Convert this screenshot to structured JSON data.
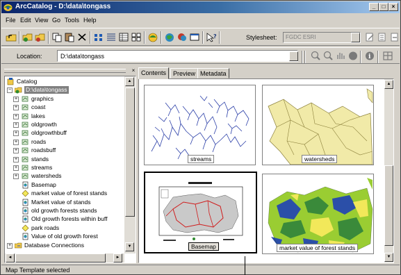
{
  "window": {
    "title": "ArcCatalog - D:\\data\\tongass",
    "minimize_glyph": "_",
    "maximize_glyph": "□",
    "close_glyph": "×"
  },
  "menu": [
    "File",
    "Edit",
    "View",
    "Go",
    "Tools",
    "Help"
  ],
  "toolbar": {
    "icons": [
      "up-one-level-icon",
      "connect-folder-icon",
      "disconnect-folder-icon",
      "copy-icon",
      "paste-icon",
      "delete-icon",
      "large-icons-icon",
      "list-icon",
      "details-icon",
      "thumbnails-icon",
      "launch-arcmap-icon",
      "metadata-icon",
      "search-icon",
      "arctoolbox-icon",
      "whats-this-icon"
    ],
    "stylesheet_label": "Stylesheet:",
    "stylesheet_value": "FGDC ESRI",
    "right_icons": [
      "edit-metadata-icon",
      "metadata-properties-icon",
      "import-metadata-icon"
    ]
  },
  "location": {
    "label": "Location:",
    "value": "D:\\data\\tongass",
    "tool_icons": [
      "zoom-in-icon",
      "zoom-out-icon",
      "pan-icon",
      "full-extent-icon",
      "identify-icon",
      "create-thumbnail-icon"
    ]
  },
  "tree": {
    "close_glyph": "×",
    "items": [
      {
        "label": "Catalog",
        "icon": "catalog-icon",
        "level": 0,
        "expander": ""
      },
      {
        "label": "D:\\data\\tongass",
        "icon": "folder-connection-icon",
        "level": 1,
        "expander": "−"
      },
      {
        "label": "graphics",
        "icon": "coverage-icon",
        "level": 2,
        "expander": "+"
      },
      {
        "label": "coast",
        "icon": "coverage-icon",
        "level": 2,
        "expander": "+"
      },
      {
        "label": "lakes",
        "icon": "coverage-icon",
        "level": 2,
        "expander": "+"
      },
      {
        "label": "oldgrowth",
        "icon": "coverage-icon",
        "level": 2,
        "expander": "+"
      },
      {
        "label": "oldgrowthbuff",
        "icon": "coverage-icon",
        "level": 2,
        "expander": "+"
      },
      {
        "label": "roads",
        "icon": "coverage-icon",
        "level": 2,
        "expander": "+"
      },
      {
        "label": "roadsbuff",
        "icon": "coverage-icon",
        "level": 2,
        "expander": "+"
      },
      {
        "label": "stands",
        "icon": "coverage-icon",
        "level": 2,
        "expander": "+"
      },
      {
        "label": "streams",
        "icon": "coverage-icon",
        "level": 2,
        "expander": "+"
      },
      {
        "label": "watersheds",
        "icon": "coverage-icon",
        "level": 2,
        "expander": "+"
      },
      {
        "label": "Basemap",
        "icon": "map-document-icon",
        "level": 2,
        "expander": ""
      },
      {
        "label": "market value of forest stands",
        "icon": "layer-file-icon",
        "level": 2,
        "expander": ""
      },
      {
        "label": "Market value of stands",
        "icon": "map-document-icon",
        "level": 2,
        "expander": ""
      },
      {
        "label": "old growth forests stands",
        "icon": "map-document-icon",
        "level": 2,
        "expander": ""
      },
      {
        "label": "Old growth forests within buff",
        "icon": "map-document-icon",
        "level": 2,
        "expander": ""
      },
      {
        "label": "park roads",
        "icon": "layer-file-icon",
        "level": 2,
        "expander": ""
      },
      {
        "label": "Value of old growth forest",
        "icon": "map-document-icon",
        "level": 2,
        "expander": ""
      },
      {
        "label": "Database Connections",
        "icon": "database-connections-icon",
        "level": 1,
        "expander": "+"
      }
    ]
  },
  "tabs": [
    "Contents",
    "Preview",
    "Metadata"
  ],
  "thumbnails": [
    {
      "label": "streams",
      "kind": "streams"
    },
    {
      "label": "watersheds",
      "kind": "watersheds"
    },
    {
      "label": "Basemap",
      "kind": "basemap",
      "selected": true
    },
    {
      "label": "market value of forest stands",
      "kind": "stands"
    }
  ],
  "status": {
    "text": "Map Template selected"
  },
  "colors": {
    "title_start": "#0a246a",
    "title_end": "#a6caf0",
    "chrome": "#d4d0c8",
    "stream_blue": "#2b3fa8",
    "watershed_fill": "#f1eaa8",
    "basemap_route": "#d01b1b"
  }
}
